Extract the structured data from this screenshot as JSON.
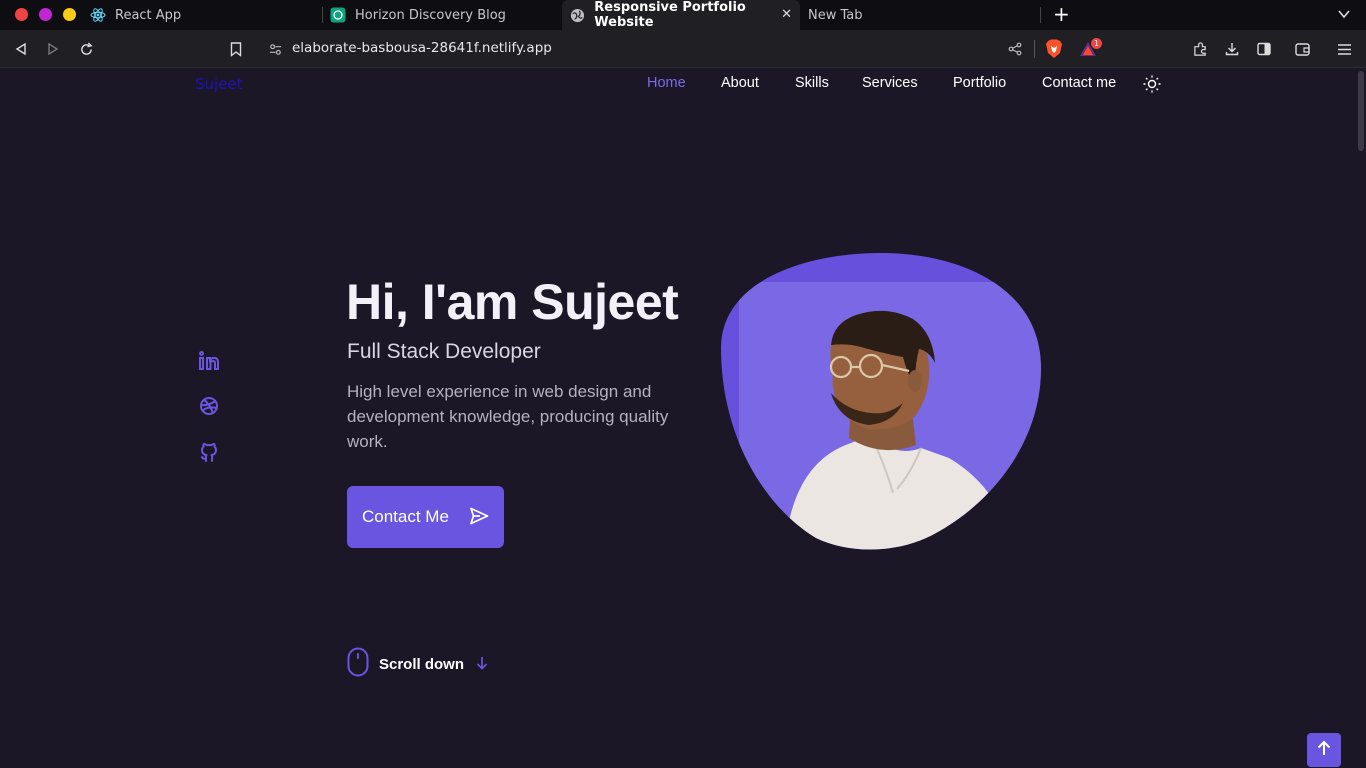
{
  "browser": {
    "tabs": [
      {
        "label": "React App",
        "icon": "react-icon"
      },
      {
        "label": "Horizon Discovery Blog",
        "icon": "chatgpt-icon"
      },
      {
        "label": "Responsive Portfolio Website",
        "icon": "globe-icon"
      },
      {
        "label": "New Tab",
        "icon": ""
      }
    ],
    "url": "elaborate-basbousa-28641f.netlify.app",
    "notification_count": "1"
  },
  "site": {
    "logo": "Sujeet",
    "nav": [
      "Home",
      "About",
      "Skills",
      "Services",
      "Portfolio",
      "Contact me"
    ],
    "hero": {
      "title": "Hi, I'am Sujeet",
      "subtitle": "Full Stack Developer",
      "description": "High level experience in web design and development knowledge, producing quality work.",
      "cta": "Contact Me"
    },
    "scroll_down": "Scroll down"
  },
  "colors": {
    "accent": "#6a55e0",
    "background": "#1b1727",
    "logo": "#1d13b5"
  }
}
